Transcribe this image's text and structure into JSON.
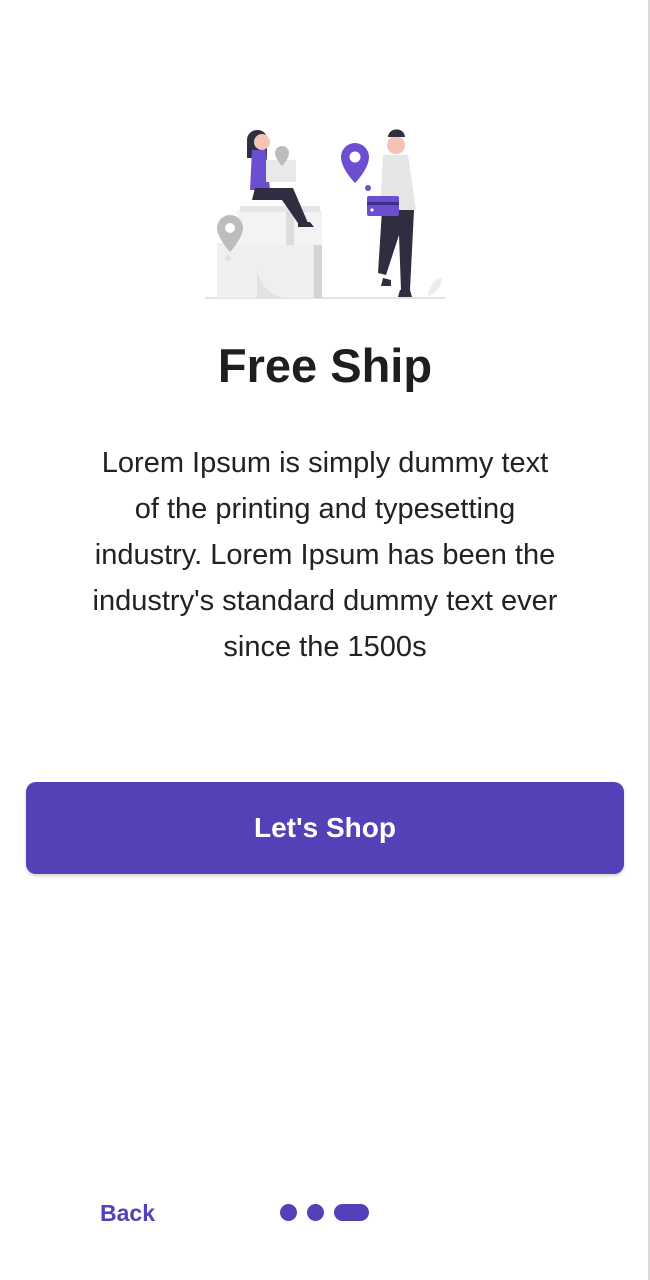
{
  "onboarding": {
    "title": "Free Ship",
    "description_lines": [
      "Lorem Ipsum is simply dummy text",
      "of the printing and typesetting",
      "industry. Lorem Ipsum has been the",
      "industry's standard dummy text ever",
      "since the 1500s"
    ],
    "cta_label": "Let's Shop",
    "back_label": "Back",
    "pager": {
      "total_pages": 3,
      "current_page": 3
    },
    "illustration": {
      "name": "delivery-illustration",
      "icons": [
        "location-pin-icon",
        "location-pin-icon",
        "location-pin-icon",
        "package-icon",
        "leaf-icon"
      ]
    }
  },
  "colors": {
    "accent": "#5640b7",
    "title_text": "#1f1d1f",
    "body_text": "#232123",
    "background": "#ffffff"
  }
}
